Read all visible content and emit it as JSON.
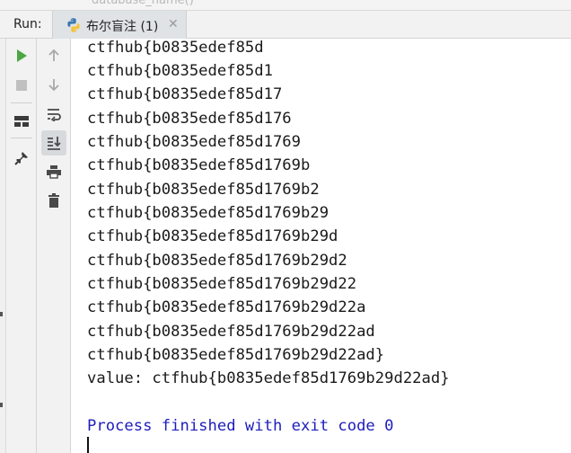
{
  "editor_breadcrumb_fragment": "database_name()",
  "run_panel": {
    "label": "Run:",
    "tab": {
      "label": "布尔盲注 (1)",
      "icon": "python-icon",
      "close_icon": "close-icon"
    }
  },
  "toolbar_left": [
    {
      "name": "rerun-icon",
      "glyph": "play",
      "color": "#4ba644"
    },
    {
      "name": "stop-icon",
      "glyph": "stop",
      "color": "#c0c0c0"
    },
    {
      "name": "restore-layout-icon",
      "glyph": "layout",
      "color": "#3b3b3b"
    },
    {
      "name": "pin-tab-icon",
      "glyph": "pin",
      "color": "#3b3b3b"
    }
  ],
  "toolbar_right": [
    {
      "name": "up-arrow-icon",
      "glyph": "up"
    },
    {
      "name": "down-arrow-icon",
      "glyph": "down"
    },
    {
      "name": "soft-wrap-icon",
      "glyph": "wrap"
    },
    {
      "name": "scroll-to-end-icon",
      "glyph": "scroll-end",
      "active": true
    },
    {
      "name": "print-icon",
      "glyph": "print"
    },
    {
      "name": "trash-icon",
      "glyph": "trash"
    }
  ],
  "console": {
    "lines": [
      "ctfhub{b0835edef85d",
      "ctfhub{b0835edef85d1",
      "ctfhub{b0835edef85d17",
      "ctfhub{b0835edef85d176",
      "ctfhub{b0835edef85d1769",
      "ctfhub{b0835edef85d1769b",
      "ctfhub{b0835edef85d1769b2",
      "ctfhub{b0835edef85d1769b29",
      "ctfhub{b0835edef85d1769b29d",
      "ctfhub{b0835edef85d1769b29d2",
      "ctfhub{b0835edef85d1769b29d22",
      "ctfhub{b0835edef85d1769b29d22a",
      "ctfhub{b0835edef85d1769b29d22ad",
      "ctfhub{b0835edef85d1769b29d22ad}",
      "value: ctfhub{b0835edef85d1769b29d22ad}"
    ],
    "process_line": "Process finished with exit code 0"
  },
  "colors": {
    "text": "#1a1a1a",
    "process_text": "#1d1dbd",
    "run_green": "#4ba644"
  }
}
